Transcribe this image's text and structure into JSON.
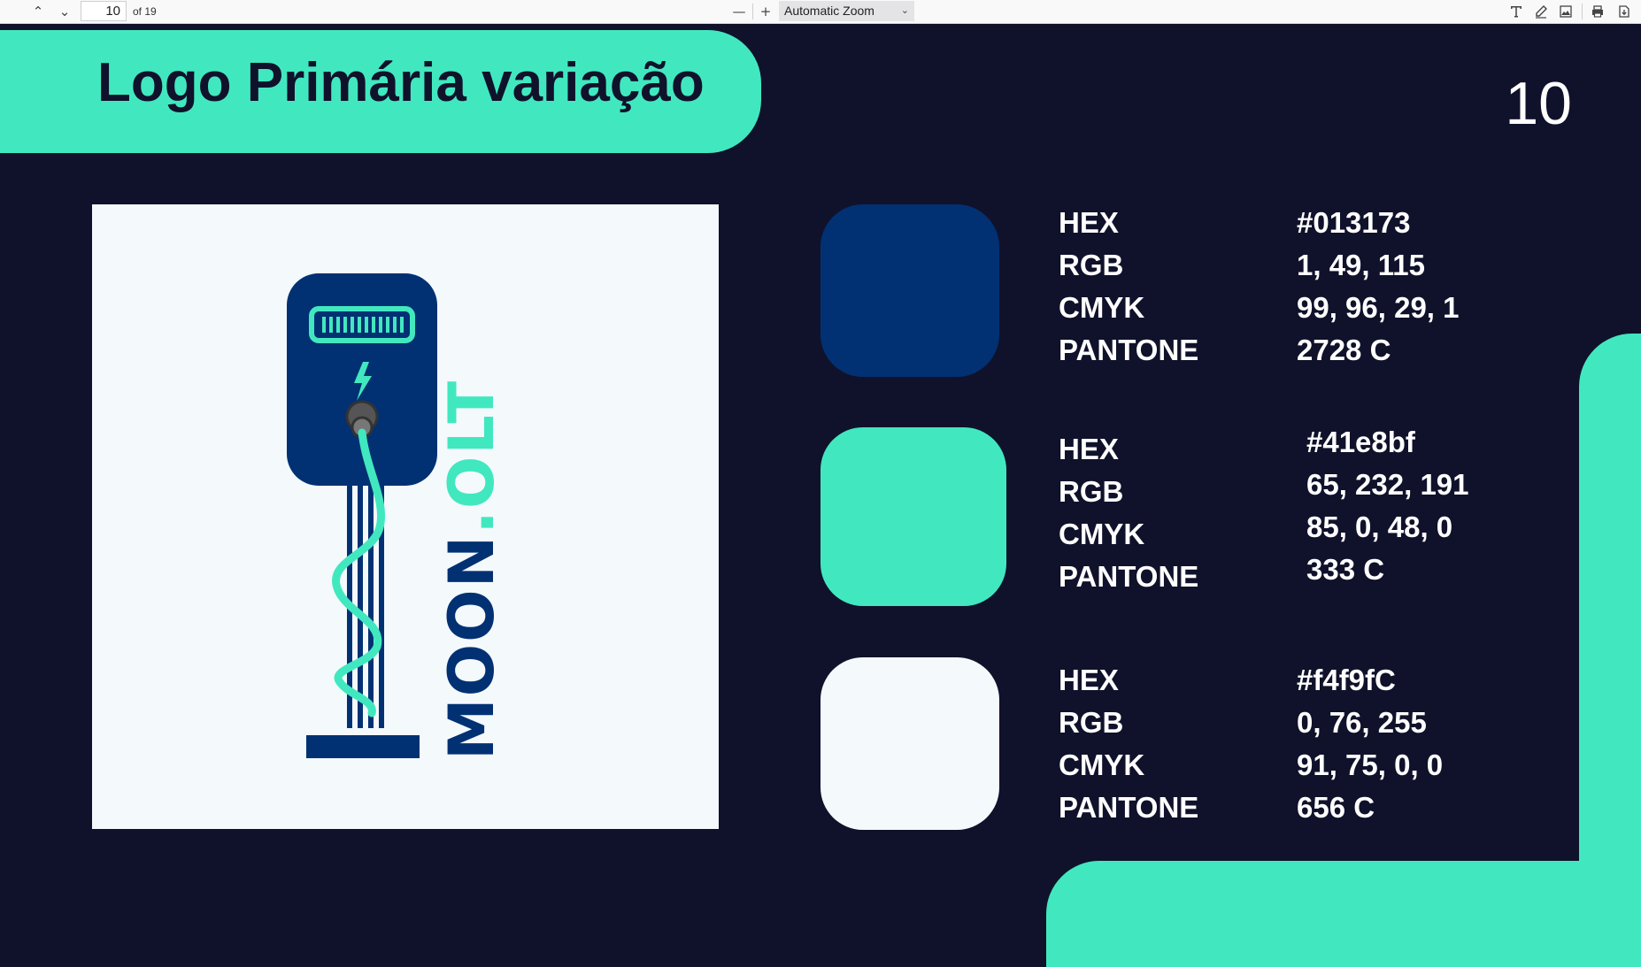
{
  "viewer": {
    "page_current": "10",
    "page_total_label": "of 19",
    "zoom_label": "Automatic Zoom",
    "icons": [
      "chevron-up-icon",
      "chevron-down-icon",
      "zoom-out-icon",
      "zoom-in-icon",
      "text-tool-icon",
      "draw-tool-icon",
      "image-tool-icon",
      "print-icon",
      "download-icon"
    ]
  },
  "slide": {
    "title": "Logo Primária variação",
    "page_number": "10",
    "logo_letters": [
      "M",
      "O",
      "O",
      "N",
      ".",
      "O",
      "L",
      "T"
    ],
    "colors_brand": {
      "navy": "#013173",
      "mint": "#41e8bf",
      "offwhite": "#f4f9fc",
      "background": "#10122b"
    },
    "swatches": [
      {
        "color": "#013173",
        "labels": [
          "HEX",
          "RGB",
          "CMYK",
          "PANTONE"
        ],
        "values": [
          "#013173",
          "1, 49, 115",
          "99, 96, 29, 1",
          "2728 C"
        ]
      },
      {
        "color": "#41e8bf",
        "labels": [
          "HEX",
          "RGB",
          "CMYK",
          "PANTONE"
        ],
        "values": [
          "#41e8bf",
          "65, 232, 191",
          "85, 0, 48, 0",
          "333 C"
        ]
      },
      {
        "color": "#f4f9fc",
        "labels": [
          "HEX",
          "RGB",
          "CMYK",
          "PANTONE"
        ],
        "values": [
          "#f4f9fC",
          "0, 76, 255",
          "91, 75, 0, 0",
          "656 C"
        ]
      }
    ]
  }
}
